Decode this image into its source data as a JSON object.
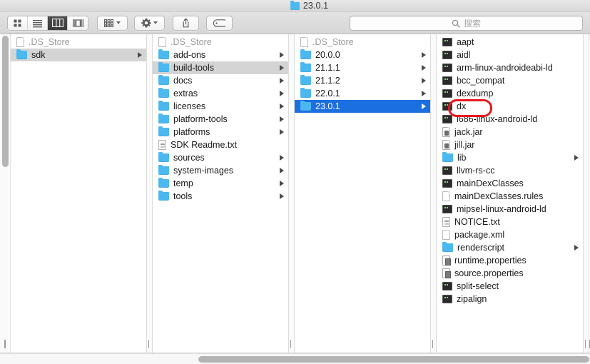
{
  "window": {
    "title": "23.0.1",
    "title_icon": "folder-icon"
  },
  "toolbar": {
    "view_modes": [
      {
        "name": "icon-view",
        "icon": "grid-icon",
        "active": false
      },
      {
        "name": "list-view",
        "icon": "list-icon",
        "active": false
      },
      {
        "name": "column-view",
        "icon": "columns-icon",
        "active": true
      },
      {
        "name": "gallery-view",
        "icon": "gallery-icon",
        "active": false
      }
    ],
    "arrange_button": {
      "name": "arrange-button",
      "icon": "grouping-icon"
    },
    "action_button": {
      "name": "action-button",
      "icon": "gear-icon"
    },
    "share_button": {
      "name": "share-button",
      "icon": "share-icon"
    },
    "tag_button": {
      "name": "tag-button",
      "icon": "tag-icon"
    }
  },
  "search": {
    "placeholder": "搜索",
    "icon": "search-icon",
    "value": ""
  },
  "columns": [
    {
      "name": "column-root",
      "items": [
        {
          "label": ".DS_Store",
          "icon": "document-icon",
          "arrow": false,
          "state": "dim"
        },
        {
          "label": "sdk",
          "icon": "folder-icon",
          "arrow": true,
          "state": "selected-inactive"
        }
      ]
    },
    {
      "name": "column-sdk",
      "items": [
        {
          "label": ".DS_Store",
          "icon": "document-icon",
          "arrow": false,
          "state": "dim"
        },
        {
          "label": "add-ons",
          "icon": "folder-icon",
          "arrow": true,
          "state": "normal"
        },
        {
          "label": "build-tools",
          "icon": "folder-icon",
          "arrow": true,
          "state": "selected-inactive"
        },
        {
          "label": "docs",
          "icon": "folder-icon",
          "arrow": true,
          "state": "normal"
        },
        {
          "label": "extras",
          "icon": "folder-icon",
          "arrow": true,
          "state": "normal"
        },
        {
          "label": "licenses",
          "icon": "folder-icon",
          "arrow": true,
          "state": "normal"
        },
        {
          "label": "platform-tools",
          "icon": "folder-icon",
          "arrow": true,
          "state": "normal"
        },
        {
          "label": "platforms",
          "icon": "folder-icon",
          "arrow": true,
          "state": "normal"
        },
        {
          "label": "SDK Readme.txt",
          "icon": "text-document-icon",
          "arrow": false,
          "state": "normal"
        },
        {
          "label": "sources",
          "icon": "folder-icon",
          "arrow": true,
          "state": "normal"
        },
        {
          "label": "system-images",
          "icon": "folder-icon",
          "arrow": true,
          "state": "normal"
        },
        {
          "label": "temp",
          "icon": "folder-icon",
          "arrow": true,
          "state": "normal"
        },
        {
          "label": "tools",
          "icon": "folder-icon",
          "arrow": true,
          "state": "normal"
        }
      ]
    },
    {
      "name": "column-build-tools",
      "items": [
        {
          "label": ".DS_Store",
          "icon": "document-icon",
          "arrow": false,
          "state": "dim"
        },
        {
          "label": "20.0.0",
          "icon": "folder-icon",
          "arrow": true,
          "state": "normal"
        },
        {
          "label": "21.1.1",
          "icon": "folder-icon",
          "arrow": true,
          "state": "normal"
        },
        {
          "label": "21.1.2",
          "icon": "folder-icon",
          "arrow": true,
          "state": "normal"
        },
        {
          "label": "22.0.1",
          "icon": "folder-icon",
          "arrow": true,
          "state": "normal"
        },
        {
          "label": "23.0.1",
          "icon": "folder-icon",
          "arrow": true,
          "state": "selected-active"
        }
      ]
    },
    {
      "name": "column-23-0-1",
      "items": [
        {
          "label": "aapt",
          "icon": "executable-icon",
          "arrow": false,
          "state": "normal"
        },
        {
          "label": "aidl",
          "icon": "executable-icon",
          "arrow": false,
          "state": "normal"
        },
        {
          "label": "arm-linux-androideabi-ld",
          "icon": "executable-icon",
          "arrow": false,
          "state": "normal"
        },
        {
          "label": "bcc_compat",
          "icon": "executable-icon",
          "arrow": false,
          "state": "normal"
        },
        {
          "label": "dexdump",
          "icon": "executable-icon",
          "arrow": false,
          "state": "normal"
        },
        {
          "label": "dx",
          "icon": "executable-icon",
          "arrow": false,
          "state": "normal",
          "annotated": true
        },
        {
          "label": "i686-linux-android-ld",
          "icon": "executable-icon",
          "arrow": false,
          "state": "normal"
        },
        {
          "label": "jack.jar",
          "icon": "jar-icon",
          "arrow": false,
          "state": "normal"
        },
        {
          "label": "jill.jar",
          "icon": "jar-icon",
          "arrow": false,
          "state": "normal"
        },
        {
          "label": "lib",
          "icon": "folder-icon",
          "arrow": true,
          "state": "normal"
        },
        {
          "label": "llvm-rs-cc",
          "icon": "executable-icon",
          "arrow": false,
          "state": "normal"
        },
        {
          "label": "mainDexClasses",
          "icon": "executable-icon",
          "arrow": false,
          "state": "normal"
        },
        {
          "label": "mainDexClasses.rules",
          "icon": "document-icon",
          "arrow": false,
          "state": "normal"
        },
        {
          "label": "mipsel-linux-android-ld",
          "icon": "executable-icon",
          "arrow": false,
          "state": "normal"
        },
        {
          "label": "NOTICE.txt",
          "icon": "text-document-icon",
          "arrow": false,
          "state": "normal"
        },
        {
          "label": "package.xml",
          "icon": "document-icon",
          "arrow": false,
          "state": "normal"
        },
        {
          "label": "renderscript",
          "icon": "folder-icon",
          "arrow": true,
          "state": "normal"
        },
        {
          "label": "runtime.properties",
          "icon": "properties-icon",
          "arrow": false,
          "state": "normal"
        },
        {
          "label": "source.properties",
          "icon": "properties-icon",
          "arrow": false,
          "state": "normal"
        },
        {
          "label": "split-select",
          "icon": "executable-icon",
          "arrow": false,
          "state": "normal"
        },
        {
          "label": "zipalign",
          "icon": "executable-icon",
          "arrow": false,
          "state": "normal"
        }
      ]
    }
  ],
  "annotation": {
    "name": "highlight-rectangle",
    "target": "dx",
    "color": "#e8181e"
  },
  "scrollbars": {
    "vertical": {
      "name": "vertical-scrollbar",
      "thumb_color": "#b4b4b4"
    },
    "horizontal": {
      "name": "horizontal-scrollbar",
      "thumb_color": "#b4b4b4"
    }
  }
}
